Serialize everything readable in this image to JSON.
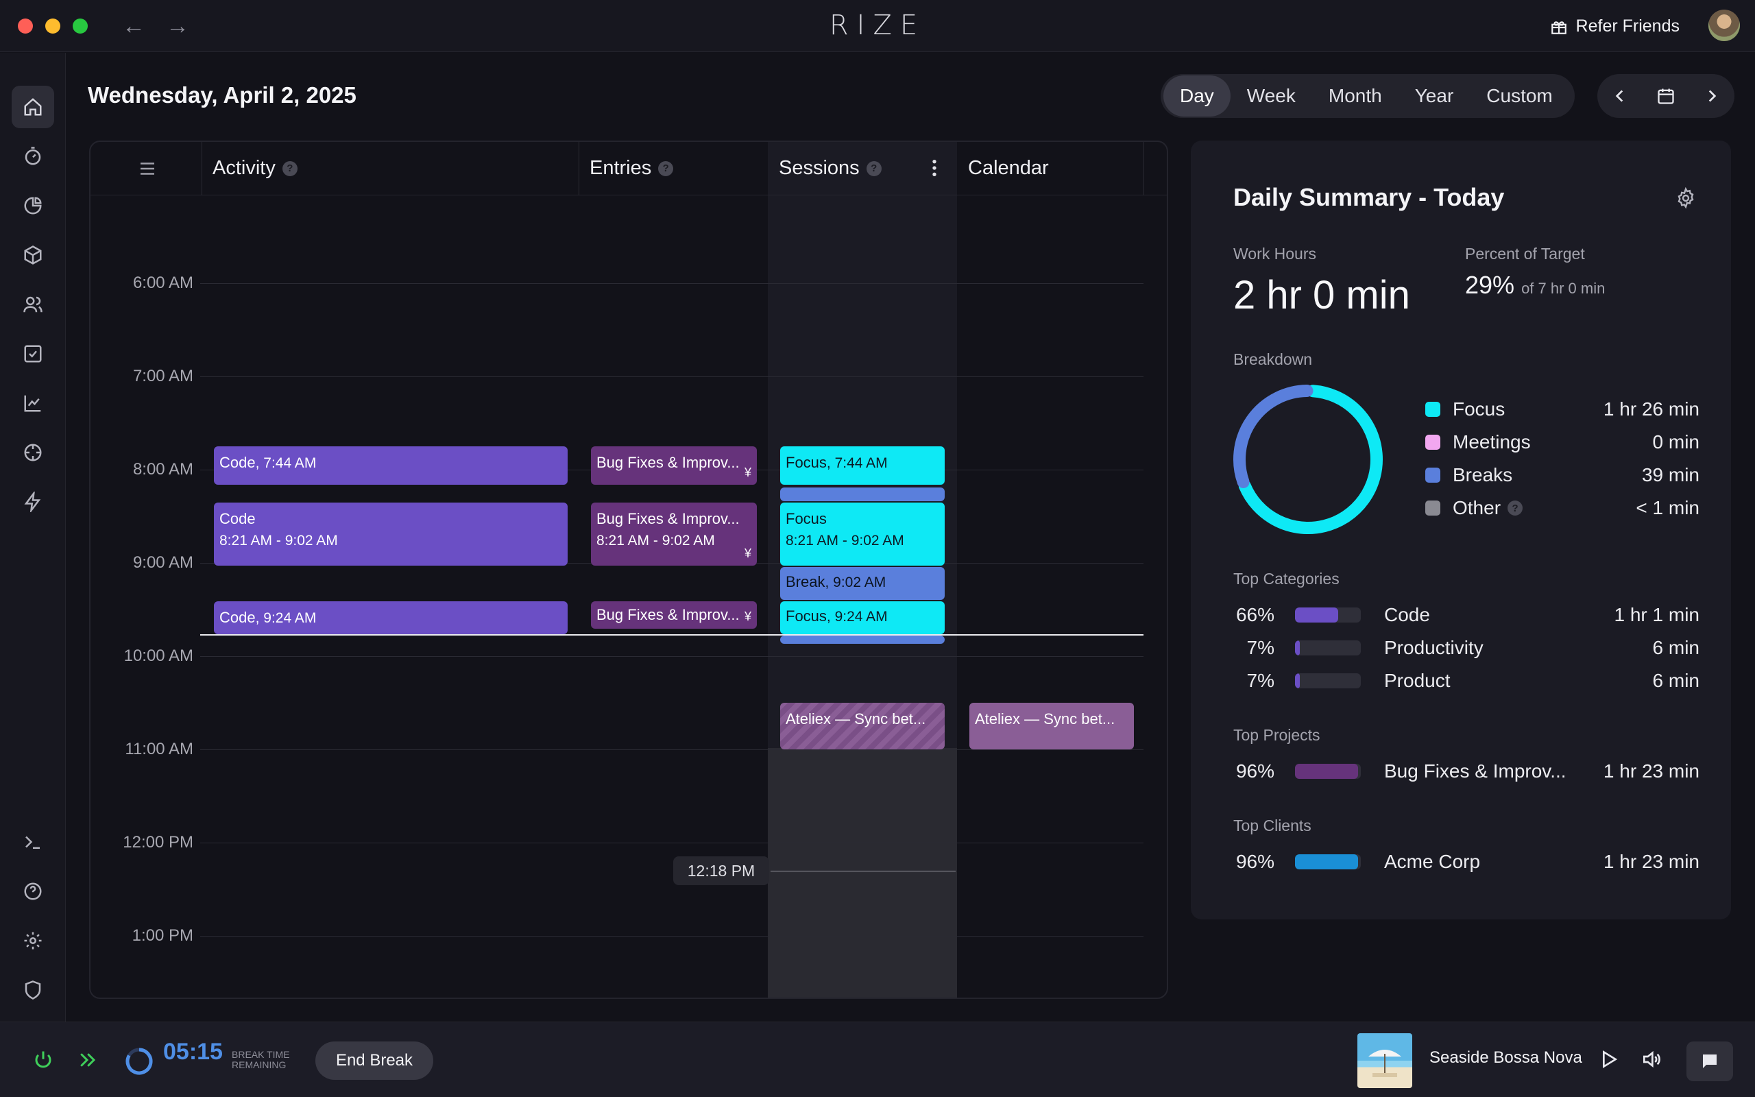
{
  "app": {
    "brand": "RIZE",
    "refer_label": "Refer Friends"
  },
  "header": {
    "date": "Wednesday, April 2, 2025",
    "views": [
      "Day",
      "Week",
      "Month",
      "Year",
      "Custom"
    ],
    "active_view": "Day"
  },
  "timeline": {
    "columns": {
      "activity": "Activity",
      "entries": "Entries",
      "sessions": "Sessions",
      "calendar": "Calendar"
    },
    "hours": [
      "6:00 AM",
      "7:00 AM",
      "8:00 AM",
      "9:00 AM",
      "10:00 AM",
      "11:00 AM",
      "12:00 PM",
      "1:00 PM"
    ],
    "activity_blocks": {
      "a1_title": "Code",
      "a1_time": ", 7:44 AM",
      "a2_title": "Code",
      "a2_time": "8:21 AM - 9:02 AM",
      "a3_title": "Code",
      "a3_time": ", 9:24 AM"
    },
    "entry_blocks": {
      "e1_title": "Bug Fixes & Improv...",
      "e2_title": "Bug Fixes & Improv...",
      "e2_time": "8:21 AM - 9:02 AM",
      "e3_title": "Bug Fixes & Improv...",
      "currency_symbol": "¥"
    },
    "session_blocks": {
      "s1_title": "Focus",
      "s1_time": ", 7:44 AM",
      "s2_title": "Focus",
      "s2_time": "8:21 AM - 9:02 AM",
      "s3_title": "Break",
      "s3_time": ", 9:02 AM",
      "s4_title": "Focus",
      "s4_time": ", 9:24 AM",
      "s5_title": "Ateliex — Sync bet..."
    },
    "calendar_blocks": {
      "c1_title": "Ateliex — Sync bet..."
    },
    "cursor_time": "12:18 PM"
  },
  "summary": {
    "title": "Daily Summary - Today",
    "work_hours_label": "Work Hours",
    "work_hours_value": "2 hr 0 min",
    "percent_label": "Percent of Target",
    "percent_value": "29%",
    "percent_of": "of 7 hr 0 min",
    "breakdown_label": "Breakdown",
    "breakdown": [
      {
        "name": "Focus",
        "value": "1 hr 26 min",
        "color": "#0ee9f5",
        "minutes": 86
      },
      {
        "name": "Meetings",
        "value": "0 min",
        "color": "#f2a7f0",
        "minutes": 0
      },
      {
        "name": "Breaks",
        "value": "39 min",
        "color": "#5a7fdc",
        "minutes": 39
      },
      {
        "name": "Other",
        "value": "< 1 min",
        "color": "#8a8a92",
        "minutes": 0.5
      }
    ],
    "top_categories_label": "Top Categories",
    "top_categories": [
      {
        "pct": "66%",
        "fraction": 0.66,
        "name": "Code",
        "value": "1 hr 1 min",
        "color": "#6b4fc5"
      },
      {
        "pct": "7%",
        "fraction": 0.07,
        "name": "Productivity",
        "value": "6 min",
        "color": "#6b4fc5"
      },
      {
        "pct": "7%",
        "fraction": 0.07,
        "name": "Product",
        "value": "6 min",
        "color": "#6b4fc5"
      }
    ],
    "top_projects_label": "Top Projects",
    "top_projects": [
      {
        "pct": "96%",
        "fraction": 0.96,
        "name": "Bug Fixes & Improv...",
        "value": "1 hr 23 min",
        "color": "#66337b"
      }
    ],
    "top_clients_label": "Top Clients",
    "top_clients": [
      {
        "pct": "96%",
        "fraction": 0.96,
        "name": "Acme Corp",
        "value": "1 hr 23 min",
        "color": "#1a8fd6"
      }
    ]
  },
  "bottom": {
    "timer": "05:15",
    "timer_label_1": "BREAK TIME",
    "timer_label_2": "REMAINING",
    "end_break": "End Break",
    "song": "Seaside Bossa Nova"
  }
}
